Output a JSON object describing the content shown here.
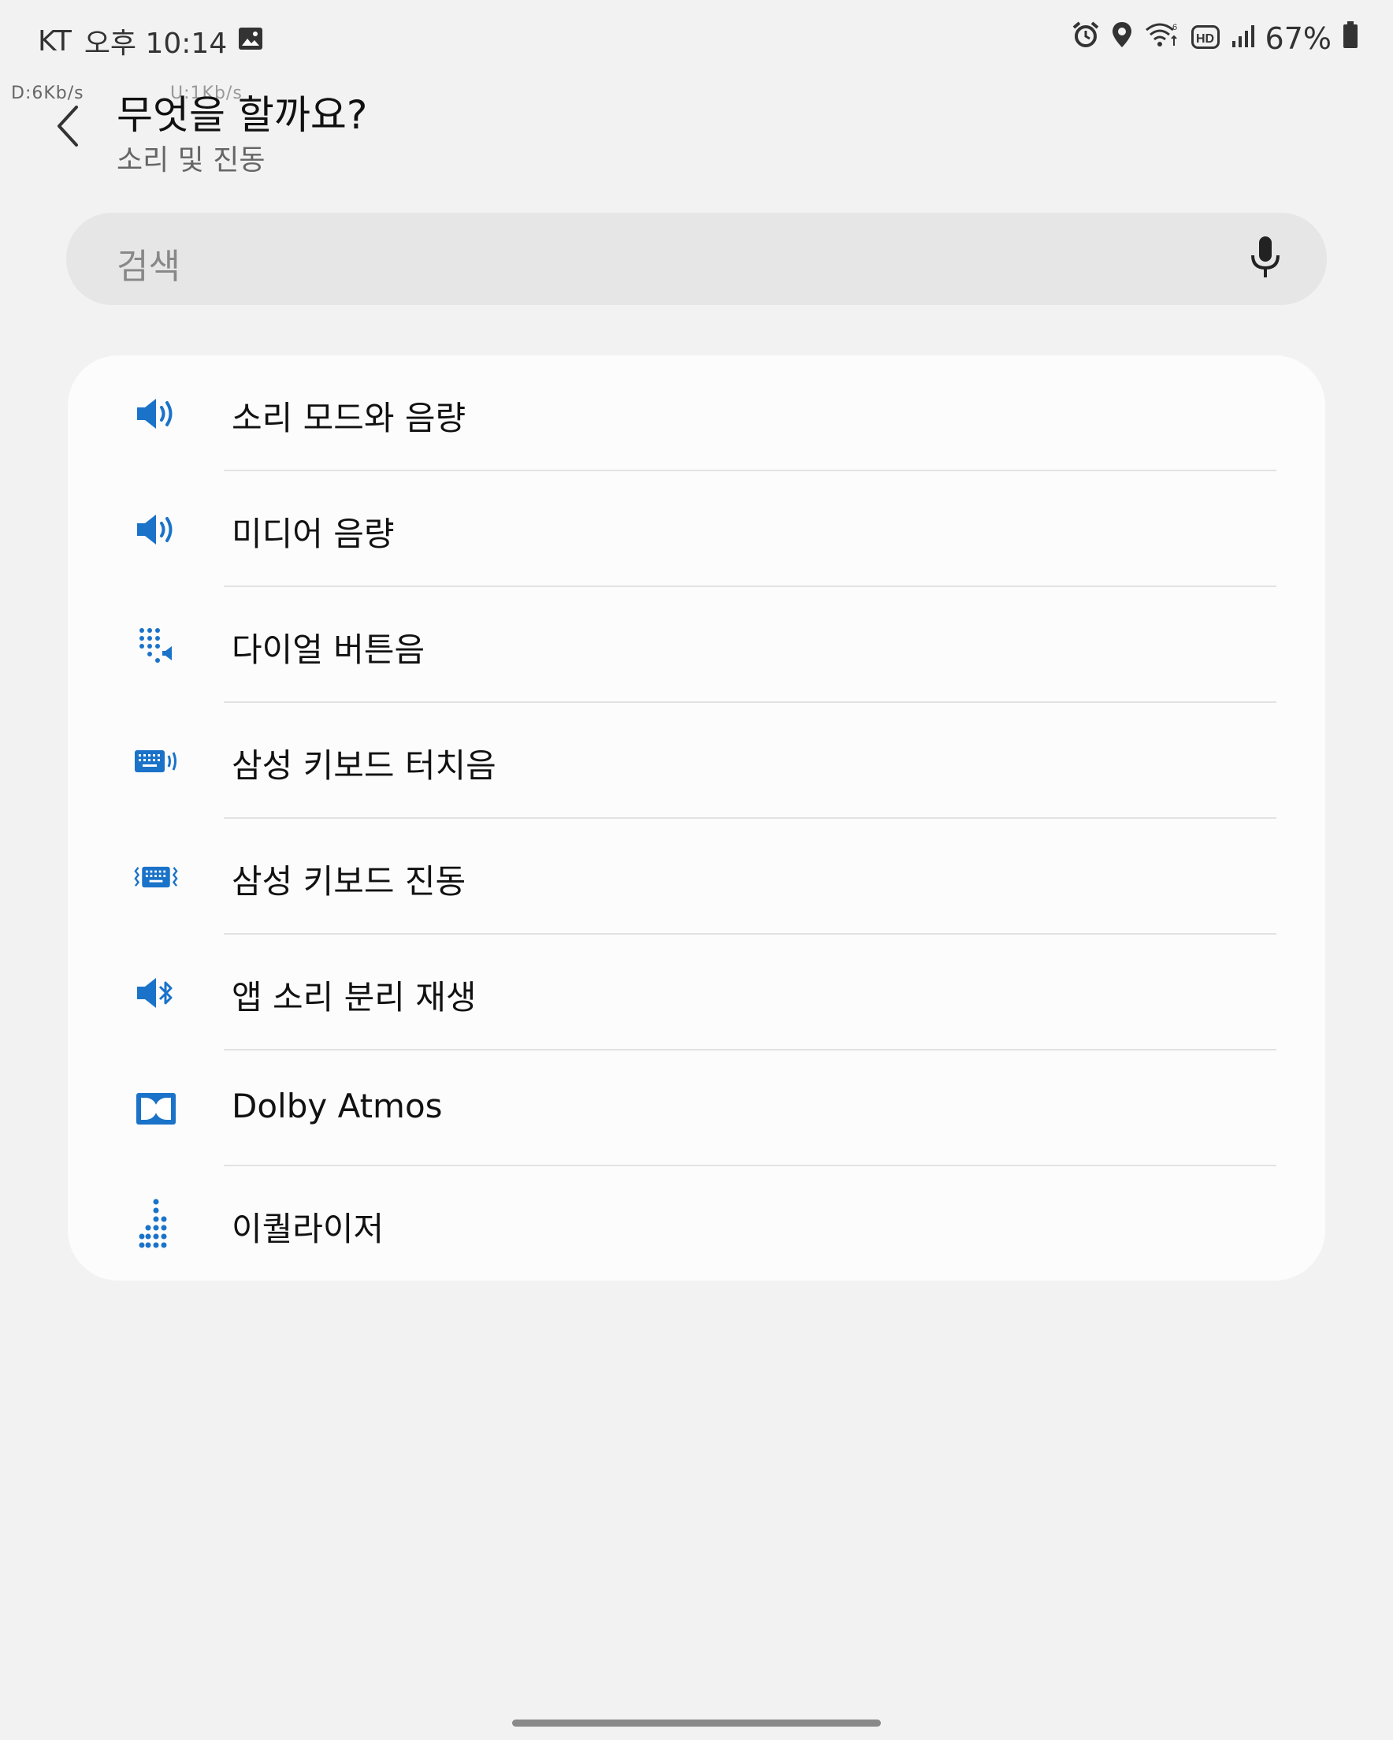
{
  "status_bar": {
    "carrier": "KT",
    "time": "오후 10:14",
    "battery": "67%",
    "net_down": "D:6Kb/s",
    "net_up": "U:1Kb/s"
  },
  "header": {
    "title": "무엇을 할까요?",
    "subtitle": "소리 및 진동"
  },
  "search": {
    "placeholder": "검색"
  },
  "accent_color": "#1a73c9",
  "items": [
    {
      "label": "소리 모드와 음량",
      "icon": "speaker-volume-icon"
    },
    {
      "label": "미디어 음량",
      "icon": "speaker-volume-icon"
    },
    {
      "label": "다이얼 버튼음",
      "icon": "dialpad-sound-icon"
    },
    {
      "label": "삼성 키보드 터치음",
      "icon": "keyboard-sound-icon"
    },
    {
      "label": "삼성 키보드 진동",
      "icon": "keyboard-vibration-icon"
    },
    {
      "label": "앱 소리 분리 재생",
      "icon": "bluetooth-speaker-icon"
    },
    {
      "label": "Dolby Atmos",
      "icon": "dolby-icon"
    },
    {
      "label": "이퀄라이저",
      "icon": "equalizer-icon"
    }
  ]
}
